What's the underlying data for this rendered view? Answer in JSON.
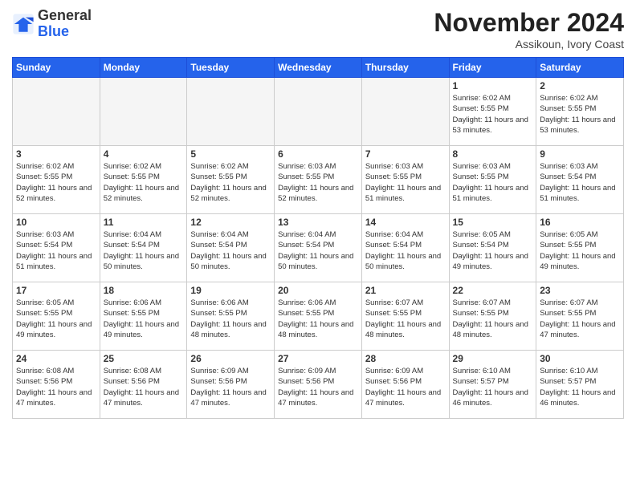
{
  "header": {
    "logo": {
      "general": "General",
      "blue": "Blue"
    },
    "title": "November 2024",
    "location": "Assikoun, Ivory Coast"
  },
  "weekdays": [
    "Sunday",
    "Monday",
    "Tuesday",
    "Wednesday",
    "Thursday",
    "Friday",
    "Saturday"
  ],
  "weeks": [
    [
      {
        "day": "",
        "empty": true
      },
      {
        "day": "",
        "empty": true
      },
      {
        "day": "",
        "empty": true
      },
      {
        "day": "",
        "empty": true
      },
      {
        "day": "",
        "empty": true
      },
      {
        "day": "1",
        "sunrise": "6:02 AM",
        "sunset": "5:55 PM",
        "daylight": "11 hours and 53 minutes."
      },
      {
        "day": "2",
        "sunrise": "6:02 AM",
        "sunset": "5:55 PM",
        "daylight": "11 hours and 53 minutes."
      }
    ],
    [
      {
        "day": "3",
        "sunrise": "6:02 AM",
        "sunset": "5:55 PM",
        "daylight": "11 hours and 52 minutes."
      },
      {
        "day": "4",
        "sunrise": "6:02 AM",
        "sunset": "5:55 PM",
        "daylight": "11 hours and 52 minutes."
      },
      {
        "day": "5",
        "sunrise": "6:02 AM",
        "sunset": "5:55 PM",
        "daylight": "11 hours and 52 minutes."
      },
      {
        "day": "6",
        "sunrise": "6:03 AM",
        "sunset": "5:55 PM",
        "daylight": "11 hours and 52 minutes."
      },
      {
        "day": "7",
        "sunrise": "6:03 AM",
        "sunset": "5:55 PM",
        "daylight": "11 hours and 51 minutes."
      },
      {
        "day": "8",
        "sunrise": "6:03 AM",
        "sunset": "5:55 PM",
        "daylight": "11 hours and 51 minutes."
      },
      {
        "day": "9",
        "sunrise": "6:03 AM",
        "sunset": "5:54 PM",
        "daylight": "11 hours and 51 minutes."
      }
    ],
    [
      {
        "day": "10",
        "sunrise": "6:03 AM",
        "sunset": "5:54 PM",
        "daylight": "11 hours and 51 minutes."
      },
      {
        "day": "11",
        "sunrise": "6:04 AM",
        "sunset": "5:54 PM",
        "daylight": "11 hours and 50 minutes."
      },
      {
        "day": "12",
        "sunrise": "6:04 AM",
        "sunset": "5:54 PM",
        "daylight": "11 hours and 50 minutes."
      },
      {
        "day": "13",
        "sunrise": "6:04 AM",
        "sunset": "5:54 PM",
        "daylight": "11 hours and 50 minutes."
      },
      {
        "day": "14",
        "sunrise": "6:04 AM",
        "sunset": "5:54 PM",
        "daylight": "11 hours and 50 minutes."
      },
      {
        "day": "15",
        "sunrise": "6:05 AM",
        "sunset": "5:54 PM",
        "daylight": "11 hours and 49 minutes."
      },
      {
        "day": "16",
        "sunrise": "6:05 AM",
        "sunset": "5:55 PM",
        "daylight": "11 hours and 49 minutes."
      }
    ],
    [
      {
        "day": "17",
        "sunrise": "6:05 AM",
        "sunset": "5:55 PM",
        "daylight": "11 hours and 49 minutes."
      },
      {
        "day": "18",
        "sunrise": "6:06 AM",
        "sunset": "5:55 PM",
        "daylight": "11 hours and 49 minutes."
      },
      {
        "day": "19",
        "sunrise": "6:06 AM",
        "sunset": "5:55 PM",
        "daylight": "11 hours and 48 minutes."
      },
      {
        "day": "20",
        "sunrise": "6:06 AM",
        "sunset": "5:55 PM",
        "daylight": "11 hours and 48 minutes."
      },
      {
        "day": "21",
        "sunrise": "6:07 AM",
        "sunset": "5:55 PM",
        "daylight": "11 hours and 48 minutes."
      },
      {
        "day": "22",
        "sunrise": "6:07 AM",
        "sunset": "5:55 PM",
        "daylight": "11 hours and 48 minutes."
      },
      {
        "day": "23",
        "sunrise": "6:07 AM",
        "sunset": "5:55 PM",
        "daylight": "11 hours and 47 minutes."
      }
    ],
    [
      {
        "day": "24",
        "sunrise": "6:08 AM",
        "sunset": "5:56 PM",
        "daylight": "11 hours and 47 minutes."
      },
      {
        "day": "25",
        "sunrise": "6:08 AM",
        "sunset": "5:56 PM",
        "daylight": "11 hours and 47 minutes."
      },
      {
        "day": "26",
        "sunrise": "6:09 AM",
        "sunset": "5:56 PM",
        "daylight": "11 hours and 47 minutes."
      },
      {
        "day": "27",
        "sunrise": "6:09 AM",
        "sunset": "5:56 PM",
        "daylight": "11 hours and 47 minutes."
      },
      {
        "day": "28",
        "sunrise": "6:09 AM",
        "sunset": "5:56 PM",
        "daylight": "11 hours and 47 minutes."
      },
      {
        "day": "29",
        "sunrise": "6:10 AM",
        "sunset": "5:57 PM",
        "daylight": "11 hours and 46 minutes."
      },
      {
        "day": "30",
        "sunrise": "6:10 AM",
        "sunset": "5:57 PM",
        "daylight": "11 hours and 46 minutes."
      }
    ]
  ]
}
